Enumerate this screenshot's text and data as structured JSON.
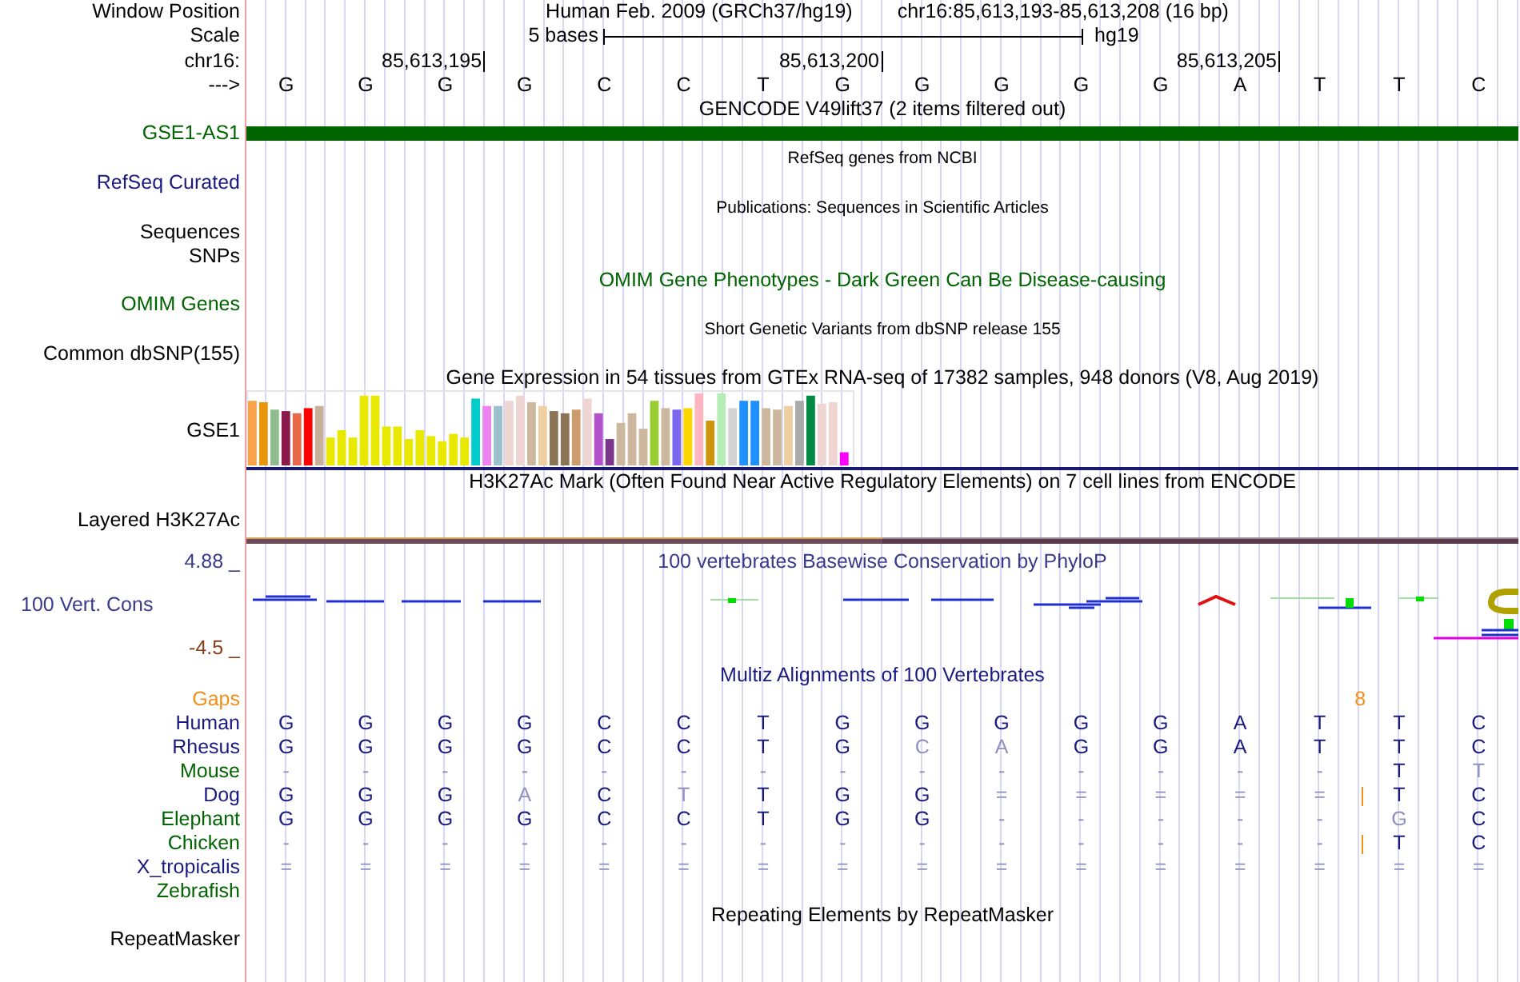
{
  "header": {
    "position_label": "Window Position",
    "assembly": "Human Feb. 2009 (GRCh37/hg19)",
    "range": "chr16:85,613,193-85,613,208 (16 bp)",
    "scale_label": "Scale",
    "scale_text": "5 bases",
    "scale_assembly": "hg19",
    "chrom_label": "chr16:",
    "ticks": [
      "85,613,195",
      "85,613,200",
      "85,613,205"
    ],
    "strand_label": "--->",
    "bases": [
      "G",
      "G",
      "G",
      "G",
      "C",
      "C",
      "T",
      "G",
      "G",
      "G",
      "G",
      "G",
      "A",
      "T",
      "T",
      "C"
    ]
  },
  "tracks": [
    {
      "kind": "title",
      "text": "GENCODE V49lift37 (2 items filtered out)",
      "color": "#000000"
    },
    {
      "kind": "gene",
      "label": "GSE1-AS1",
      "color": "#006400"
    },
    {
      "kind": "note",
      "text": "RefSeq genes from NCBI"
    },
    {
      "kind": "label",
      "label": "RefSeq Curated",
      "color": "#1a1a80"
    },
    {
      "kind": "note",
      "text": "Publications: Sequences in Scientific Articles"
    },
    {
      "kind": "label",
      "label": "Sequences",
      "color": "#000000"
    },
    {
      "kind": "label",
      "label": "SNPs",
      "color": "#000000"
    },
    {
      "kind": "title",
      "text": "OMIM Gene Phenotypes - Dark Green Can Be Disease-causing",
      "color": "#006400"
    },
    {
      "kind": "label",
      "label": "OMIM Genes",
      "color": "#006400"
    },
    {
      "kind": "note",
      "text": "Short Genetic Variants from dbSNP release 155"
    },
    {
      "kind": "label",
      "label": "Common dbSNP(155)",
      "color": "#000000"
    },
    {
      "kind": "title",
      "text": "Gene Expression in 54 tissues from GTEx RNA-seq of 17382 samples, 948 donors (V8, Aug 2019)",
      "color": "#000000"
    },
    {
      "kind": "expression",
      "label": "GSE1"
    },
    {
      "kind": "title",
      "text": "H3K27Ac Mark (Often Found Near Active Regulatory Elements) on 7 cell lines from ENCODE",
      "color": "#000000"
    },
    {
      "kind": "signal",
      "label": "Layered H3K27Ac"
    },
    {
      "kind": "conservation",
      "label": "100 Vert. Cons",
      "max": "4.88 _",
      "min": "-4.5 _",
      "title": "100 vertebrates Basewise Conservation by PhyloP"
    },
    {
      "kind": "title",
      "text": "Multiz Alignments of 100 Vertebrates",
      "color": "#1a1a80"
    },
    {
      "kind": "gaps",
      "label": "Gaps",
      "gap": "8",
      "color": "#f0901a"
    },
    {
      "kind": "species",
      "label": "Human",
      "color": "#1a1a80",
      "insert": false,
      "bases": [
        {
          "text": "G",
          "faded": false
        },
        {
          "text": "G",
          "faded": false
        },
        {
          "text": "G",
          "faded": false
        },
        {
          "text": "G",
          "faded": false
        },
        {
          "text": "C",
          "faded": false
        },
        {
          "text": "C",
          "faded": false
        },
        {
          "text": "T",
          "faded": false
        },
        {
          "text": "G",
          "faded": false
        },
        {
          "text": "G",
          "faded": false
        },
        {
          "text": "G",
          "faded": false
        },
        {
          "text": "G",
          "faded": false
        },
        {
          "text": "G",
          "faded": false
        },
        {
          "text": "A",
          "faded": false
        },
        {
          "text": "T",
          "faded": false
        },
        {
          "text": "T",
          "faded": false
        },
        {
          "text": "C",
          "faded": false
        }
      ]
    },
    {
      "kind": "species",
      "label": "Rhesus",
      "color": "#1a1a80",
      "insert": false,
      "bases": [
        {
          "text": "G",
          "faded": false
        },
        {
          "text": "G",
          "faded": false
        },
        {
          "text": "G",
          "faded": false
        },
        {
          "text": "G",
          "faded": false
        },
        {
          "text": "C",
          "faded": false
        },
        {
          "text": "C",
          "faded": false
        },
        {
          "text": "T",
          "faded": false
        },
        {
          "text": "G",
          "faded": false
        },
        {
          "text": "C",
          "faded": true
        },
        {
          "text": "A",
          "faded": true
        },
        {
          "text": "G",
          "faded": false
        },
        {
          "text": "G",
          "faded": false
        },
        {
          "text": "A",
          "faded": false
        },
        {
          "text": "T",
          "faded": false
        },
        {
          "text": "T",
          "faded": false
        },
        {
          "text": "C",
          "faded": false
        }
      ]
    },
    {
      "kind": "species",
      "label": "Mouse",
      "color": "#006400",
      "insert": false,
      "bases": [
        {
          "text": "-",
          "faded": true
        },
        {
          "text": "-",
          "faded": true
        },
        {
          "text": "-",
          "faded": true
        },
        {
          "text": "-",
          "faded": true
        },
        {
          "text": "-",
          "faded": true
        },
        {
          "text": "-",
          "faded": true
        },
        {
          "text": "-",
          "faded": true
        },
        {
          "text": "-",
          "faded": true
        },
        {
          "text": "-",
          "faded": true
        },
        {
          "text": "-",
          "faded": true
        },
        {
          "text": "-",
          "faded": true
        },
        {
          "text": "-",
          "faded": true
        },
        {
          "text": "-",
          "faded": true
        },
        {
          "text": "-",
          "faded": true
        },
        {
          "text": "T",
          "faded": false
        },
        {
          "text": "T",
          "faded": true
        }
      ]
    },
    {
      "kind": "species",
      "label": "Dog",
      "color": "#1a1a80",
      "insert": true,
      "bases": [
        {
          "text": "G",
          "faded": false
        },
        {
          "text": "G",
          "faded": false
        },
        {
          "text": "G",
          "faded": false
        },
        {
          "text": "A",
          "faded": true
        },
        {
          "text": "C",
          "faded": false
        },
        {
          "text": "T",
          "faded": true
        },
        {
          "text": "T",
          "faded": false
        },
        {
          "text": "G",
          "faded": false
        },
        {
          "text": "G",
          "faded": false
        },
        {
          "text": "=",
          "faded": true
        },
        {
          "text": "=",
          "faded": true
        },
        {
          "text": "=",
          "faded": true
        },
        {
          "text": "=",
          "faded": true
        },
        {
          "text": "=",
          "faded": true
        },
        {
          "text": "T",
          "faded": false
        },
        {
          "text": "C",
          "faded": false
        }
      ]
    },
    {
      "kind": "species",
      "label": "Elephant",
      "color": "#006400",
      "insert": false,
      "bases": [
        {
          "text": "G",
          "faded": false
        },
        {
          "text": "G",
          "faded": false
        },
        {
          "text": "G",
          "faded": false
        },
        {
          "text": "G",
          "faded": false
        },
        {
          "text": "C",
          "faded": false
        },
        {
          "text": "C",
          "faded": false
        },
        {
          "text": "T",
          "faded": false
        },
        {
          "text": "G",
          "faded": false
        },
        {
          "text": "G",
          "faded": false
        },
        {
          "text": "-",
          "faded": true
        },
        {
          "text": "-",
          "faded": true
        },
        {
          "text": "-",
          "faded": true
        },
        {
          "text": "-",
          "faded": true
        },
        {
          "text": "-",
          "faded": true
        },
        {
          "text": "G",
          "faded": true
        },
        {
          "text": "C",
          "faded": false
        }
      ]
    },
    {
      "kind": "species",
      "label": "Chicken",
      "color": "#006400",
      "insert": true,
      "bases": [
        {
          "text": "-",
          "faded": true
        },
        {
          "text": "-",
          "faded": true
        },
        {
          "text": "-",
          "faded": true
        },
        {
          "text": "-",
          "faded": true
        },
        {
          "text": "-",
          "faded": true
        },
        {
          "text": "-",
          "faded": true
        },
        {
          "text": "-",
          "faded": true
        },
        {
          "text": "-",
          "faded": true
        },
        {
          "text": "-",
          "faded": true
        },
        {
          "text": "-",
          "faded": true
        },
        {
          "text": "-",
          "faded": true
        },
        {
          "text": "-",
          "faded": true
        },
        {
          "text": "-",
          "faded": true
        },
        {
          "text": "-",
          "faded": true
        },
        {
          "text": "T",
          "faded": false
        },
        {
          "text": "C",
          "faded": false
        }
      ]
    },
    {
      "kind": "species",
      "label": "X_tropicalis",
      "color": "#1a1a80",
      "insert": false,
      "bases": [
        {
          "text": "=",
          "faded": true
        },
        {
          "text": "=",
          "faded": true
        },
        {
          "text": "=",
          "faded": true
        },
        {
          "text": "=",
          "faded": true
        },
        {
          "text": "=",
          "faded": true
        },
        {
          "text": "=",
          "faded": true
        },
        {
          "text": "=",
          "faded": true
        },
        {
          "text": "=",
          "faded": true
        },
        {
          "text": "=",
          "faded": true
        },
        {
          "text": "=",
          "faded": true
        },
        {
          "text": "=",
          "faded": true
        },
        {
          "text": "=",
          "faded": true
        },
        {
          "text": "=",
          "faded": true
        },
        {
          "text": "=",
          "faded": true
        },
        {
          "text": "=",
          "faded": true
        },
        {
          "text": "=",
          "faded": true
        }
      ]
    },
    {
      "kind": "species",
      "label": "Zebrafish",
      "color": "#006400",
      "insert": false
    },
    {
      "kind": "title",
      "text": "Repeating Elements by RepeatMasker",
      "color": "#000000"
    },
    {
      "kind": "label",
      "label": "RepeatMasker",
      "color": "#000000"
    }
  ]
}
